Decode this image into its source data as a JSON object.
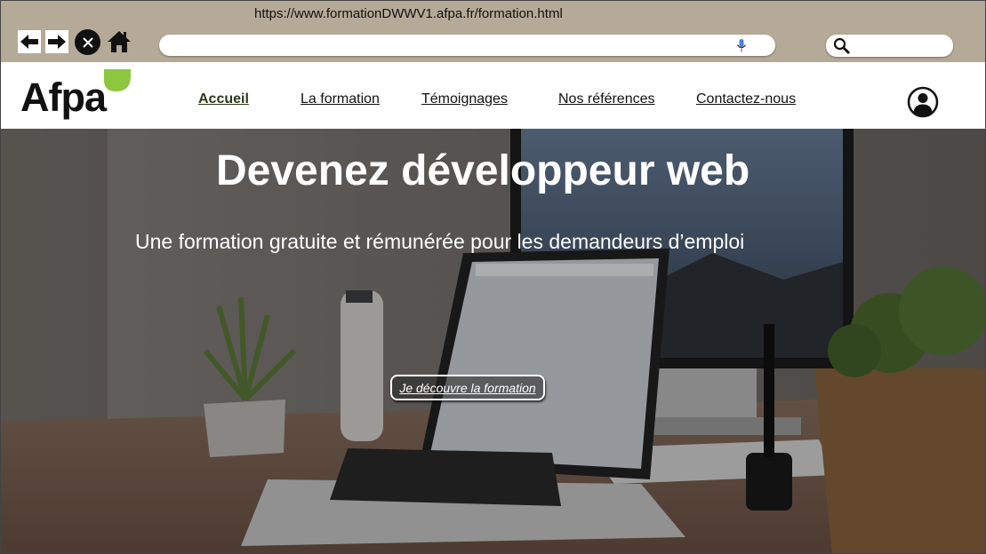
{
  "browser": {
    "url": "https://www.formationDWWV1.afpa.fr/formation.html",
    "address_value": "",
    "search_value": "",
    "icons": [
      "back-arrow-icon",
      "forward-arrow-icon",
      "close-icon",
      "home-icon",
      "microphone-icon",
      "search-icon"
    ]
  },
  "header": {
    "logo_text": "Afpa",
    "logo_leaf_color": "#8dc63f",
    "nav": [
      {
        "label": "Accueil",
        "active": true
      },
      {
        "label": "La formation"
      },
      {
        "label": "Témoignages"
      },
      {
        "label": "Nos références"
      },
      {
        "label": "Contactez-nous"
      }
    ],
    "user_icon": "user-account-icon"
  },
  "hero": {
    "title": "Devenez développeur web",
    "subtitle": "Une formation gratuite et rémunérée pour les demandeurs d’emploi",
    "cta_label": "Je découvre la formation"
  },
  "colors": {
    "chrome_bg": "#b5aa97",
    "accent_green": "#8dc63f",
    "active_nav": "#2e3a1a"
  }
}
